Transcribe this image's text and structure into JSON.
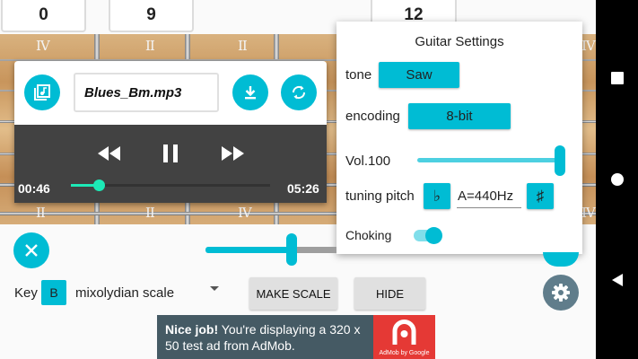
{
  "counters": [
    "0",
    "9",
    "12"
  ],
  "fret_markers": [
    "IV",
    "II",
    "II",
    "IV",
    "IV",
    "II",
    "II",
    "IV",
    "IV",
    "IV"
  ],
  "player": {
    "filename": "Blues_Bm.mp3",
    "current_time": "00:46",
    "total_time": "05:26",
    "progress": 0.14
  },
  "settings": {
    "title": "Guitar Settings",
    "tone_label": "tone",
    "tone_value": "Saw",
    "encoding_label": "encoding",
    "encoding_value": "8-bit",
    "volume_label": "Vol.100",
    "volume": 100,
    "tuning_label": "tuning pitch",
    "flat_symbol": "♭",
    "pitch_value": "A=440Hz",
    "sharp_symbol": "♯",
    "choking_label": "Choking",
    "choking_on": true
  },
  "main_slider": {
    "value": 0.66
  },
  "bottom": {
    "key_label": "Key",
    "key_value": "B",
    "scale_value": "mixolydian scale",
    "make_scale_label": "MAKE SCALE",
    "hide_label": "HIDE"
  },
  "ad": {
    "bold": "Nice job!",
    "text": " You're displaying a 320 x 50 test ad from AdMob.",
    "logo_caption": "AdMob by Google"
  },
  "icons": {
    "music_file": "music-file-icon",
    "download": "download-icon",
    "repeat": "repeat-icon",
    "rewind": "rewind-icon",
    "pause": "pause-icon",
    "fast_forward": "fast-forward-icon",
    "close": "close-icon",
    "gear": "gear-icon",
    "dropdown": "dropdown-arrow-icon",
    "nav_square": "recents-icon",
    "nav_circle": "home-icon",
    "nav_triangle": "back-icon"
  },
  "colors": {
    "accent": "#00bcd4",
    "player_dark": "#424242",
    "progress": "#1de9b6",
    "ad_bg": "#455a64"
  }
}
